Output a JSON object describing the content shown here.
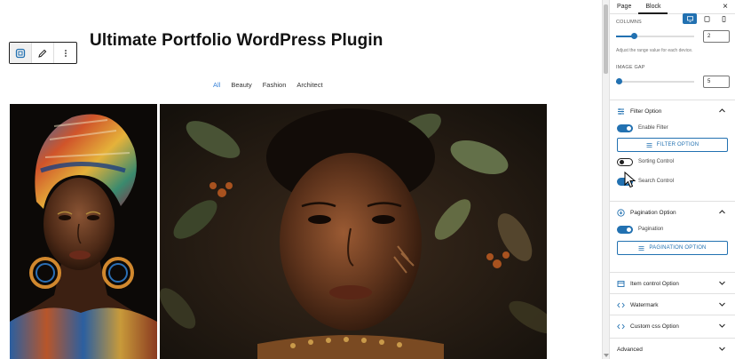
{
  "canvas": {
    "title": "Ultimate Portfolio WordPress Plugin",
    "toolbar": {
      "icons": [
        "portfolio-block-icon",
        "pencil-icon",
        "more-vertical-icon"
      ]
    },
    "filters": [
      {
        "label": "All",
        "active": true
      },
      {
        "label": "Beauty",
        "active": false
      },
      {
        "label": "Fashion",
        "active": false
      },
      {
        "label": "Architect",
        "active": false
      }
    ],
    "gallery": [
      {
        "name": "portrait-headwrap"
      },
      {
        "name": "portrait-leaves"
      }
    ]
  },
  "sidebar": {
    "tabs": [
      {
        "label": "Page",
        "active": false
      },
      {
        "label": "Block",
        "active": true
      }
    ],
    "columns": {
      "label": "COLUMNS",
      "value": "2",
      "help": "Adjust the range value for each device.",
      "level": 0.23
    },
    "image_gap": {
      "label": "IMAGE GAP",
      "value": "5",
      "level": 0.03
    },
    "filter_option": {
      "title": "Filter Option",
      "toggles": [
        {
          "label": "Enable Filter",
          "on": true
        }
      ],
      "button": "FILTER OPTION",
      "extra_toggles": [
        {
          "label": "Sorting Control",
          "on": false
        },
        {
          "label": "Search Control",
          "on": true
        }
      ]
    },
    "pagination_option": {
      "title": "Pagination Option",
      "toggle": {
        "label": "Pagination",
        "on": true
      },
      "button": "PAGINATION OPTION"
    },
    "collapsed_panels": [
      {
        "title": "Item control Option",
        "icon": "item-control-icon"
      },
      {
        "title": "Watermark",
        "icon": "code-icon"
      },
      {
        "title": "Custom css Option",
        "icon": "code-icon"
      },
      {
        "title": "Advanced",
        "icon": ""
      }
    ]
  },
  "colors": {
    "accent": "#2271b1",
    "filter_active": "#3a84d9"
  }
}
